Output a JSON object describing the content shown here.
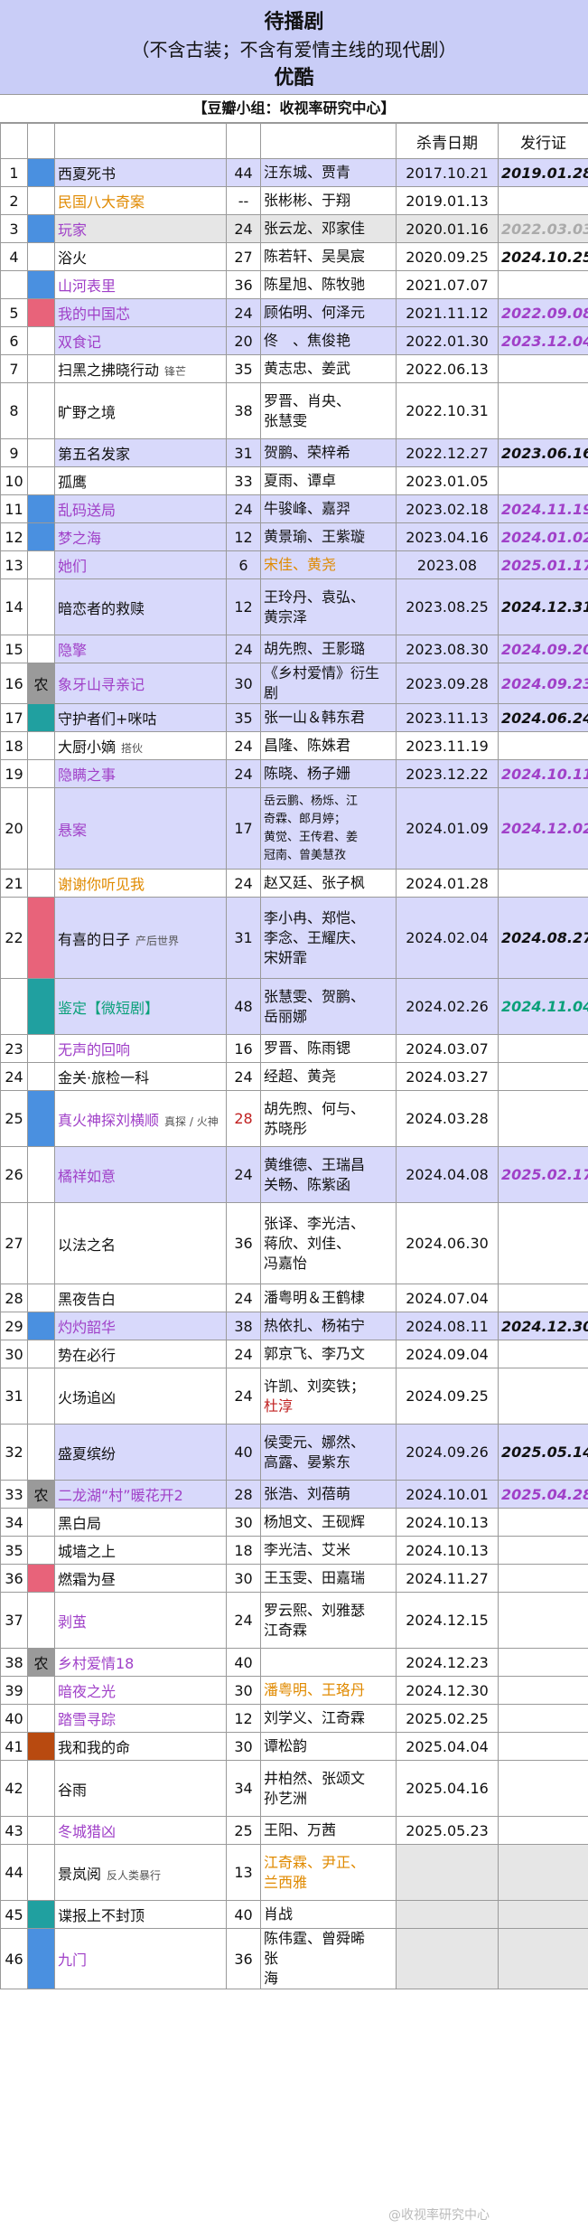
{
  "title": "待播剧",
  "subtitle": "（不含古装；不含有爱情主线的现代剧）",
  "platform": "优酷",
  "group": "【豆瓣小组：收视率研究中心】",
  "columns": {
    "wrap_date": "杀青日期",
    "license": "发行证"
  },
  "rows": [
    {
      "no": "1",
      "mark": "#4a90e0",
      "title": "西夏死书",
      "title_color": "#111",
      "tag": "",
      "ep": "44",
      "cast": [
        "汪东城、贾青"
      ],
      "date": "2017.10.21",
      "lic": "2019.01.28",
      "lic_color": "#111",
      "bg": "#d8d9fb",
      "h": 31
    },
    {
      "no": "2",
      "mark": "",
      "title": "民国八大奇案",
      "title_color": "#e08a00",
      "tag": "",
      "ep": "--",
      "cast": [
        "张彬彬、于翔"
      ],
      "date": "2019.01.13",
      "lic": "",
      "lic_color": "#111",
      "bg": "",
      "h": 31
    },
    {
      "no": "3",
      "mark": "#4a90e0",
      "title": "玩家",
      "title_color": "#a040c8",
      "tag": "",
      "ep": "24",
      "cast": [
        "张云龙、邓家佳"
      ],
      "date": "2020.01.16",
      "lic": "2022.03.03",
      "lic_color": "#aaaaaa",
      "bg": "#e6e6e6",
      "h": 31
    },
    {
      "no": "4",
      "mark": "",
      "title": "浴火",
      "title_color": "#111",
      "tag": "",
      "ep": "27",
      "cast": [
        "陈若轩、吴昊宸"
      ],
      "date": "2020.09.25",
      "lic": "2024.10.25",
      "lic_color": "#111",
      "bg": "",
      "h": 31
    },
    {
      "no": "",
      "mark": "#4a90e0",
      "title": "山河表里",
      "title_color": "#a040c8",
      "tag": "",
      "ep": "36",
      "cast": [
        "陈星旭、陈牧驰"
      ],
      "date": "2021.07.07",
      "lic": "",
      "lic_color": "#111",
      "bg": "",
      "h": 31
    },
    {
      "no": "5",
      "mark": "#e8637a",
      "title": "我的中国芯",
      "title_color": "#a040c8",
      "tag": "",
      "ep": "24",
      "cast": [
        "顾佑明、何泽元"
      ],
      "date": "2021.11.12",
      "lic": "2022.09.08",
      "lic_color": "#a040c8",
      "bg": "#d8d9fb",
      "h": 31
    },
    {
      "no": "6",
      "mark": "",
      "title": "双食记",
      "title_color": "#a040c8",
      "tag": "",
      "ep": "20",
      "cast": [
        "佟　、焦俊艳"
      ],
      "date": "2022.01.30",
      "lic": "2023.12.04",
      "lic_color": "#a040c8",
      "bg": "#d8d9fb",
      "h": 31
    },
    {
      "no": "7",
      "mark": "",
      "title": "扫黑之拂晓行动",
      "title_color": "#111",
      "tag": "锋芒",
      "ep": "35",
      "cast": [
        "黄志忠、姜武"
      ],
      "date": "2022.06.13",
      "lic": "",
      "lic_color": "#111",
      "bg": "",
      "h": 31
    },
    {
      "no": "8",
      "mark": "",
      "title": "旷野之境",
      "title_color": "#111",
      "tag": "",
      "ep": "38",
      "cast": [
        "罗晋、肖央、",
        "张慧雯"
      ],
      "date": "2022.10.31",
      "lic": "",
      "lic_color": "#111",
      "bg": "",
      "h": 62
    },
    {
      "no": "9",
      "mark": "",
      "title": "第五名发家",
      "title_color": "#111",
      "tag": "",
      "ep": "31",
      "cast": [
        "贺鹏、荣梓希"
      ],
      "date": "2022.12.27",
      "lic": "2023.06.16",
      "lic_color": "#111",
      "bg": "#d8d9fb",
      "h": 31
    },
    {
      "no": "10",
      "mark": "",
      "title": "孤鹰",
      "title_color": "#111",
      "tag": "",
      "ep": "33",
      "cast": [
        "夏雨、谭卓"
      ],
      "date": "2023.01.05",
      "lic": "",
      "lic_color": "#111",
      "bg": "",
      "h": 31
    },
    {
      "no": "11",
      "mark": "#4a90e0",
      "title": "乱码送局",
      "title_color": "#a040c8",
      "tag": "",
      "ep": "24",
      "cast": [
        "牛骏峰、嘉羿"
      ],
      "date": "2023.02.18",
      "lic": "2024.11.19",
      "lic_color": "#a040c8",
      "bg": "#d8d9fb",
      "h": 31
    },
    {
      "no": "12",
      "mark": "#4a90e0",
      "title": "梦之海",
      "title_color": "#a040c8",
      "tag": "",
      "ep": "12",
      "cast": [
        "黄景瑜、王紫璇"
      ],
      "date": "2023.04.16",
      "lic": "2024.01.02",
      "lic_color": "#a040c8",
      "bg": "#d8d9fb",
      "h": 31
    },
    {
      "no": "13",
      "mark": "",
      "title": "她们",
      "title_color": "#a040c8",
      "tag": "",
      "ep": "6",
      "cast": [
        "宋佳、黄尧"
      ],
      "cast_color": "#e08a00",
      "date": "2023.08",
      "lic": "2025.01.17",
      "lic_color": "#a040c8",
      "bg": "#d8d9fb",
      "h": 31
    },
    {
      "no": "14",
      "mark": "",
      "title": "暗恋者的救赎",
      "title_color": "#111",
      "tag": "",
      "ep": "12",
      "cast": [
        "王玲丹、袁弘、",
        "黄宗泽"
      ],
      "date": "2023.08.25",
      "lic": "2024.12.31",
      "lic_color": "#111",
      "bg": "#d8d9fb",
      "h": 62
    },
    {
      "no": "15",
      "mark": "",
      "title": "隐擎",
      "title_color": "#a040c8",
      "tag": "",
      "ep": "24",
      "cast": [
        "胡先煦、王影璐"
      ],
      "date": "2023.08.30",
      "lic": "2024.09.20",
      "lic_color": "#a040c8",
      "bg": "#d8d9fb",
      "h": 31
    },
    {
      "no": "16",
      "mark": "农",
      "title": "象牙山寻亲记",
      "title_color": "#a040c8",
      "tag": "",
      "ep": "30",
      "cast": [
        "《乡村爱情》衍生剧"
      ],
      "date": "2023.09.28",
      "lic": "2024.09.23",
      "lic_color": "#a040c8",
      "bg": "#d8d9fb",
      "h": 31
    },
    {
      "no": "17",
      "mark": "#20a0a0",
      "title": "守护者们+咪咕",
      "title_color": "#111",
      "tag": "",
      "ep": "35",
      "cast": [
        "张一山＆韩东君"
      ],
      "date": "2023.11.13",
      "lic": "2024.06.24",
      "lic_color": "#111",
      "bg": "#d8d9fb",
      "h": 31
    },
    {
      "no": "18",
      "mark": "",
      "title": "大厨小嫡",
      "title_color": "#111",
      "tag": "搭伙",
      "ep": "24",
      "cast": [
        "昌隆、陈姝君"
      ],
      "date": "2023.11.19",
      "lic": "",
      "lic_color": "#111",
      "bg": "",
      "h": 31
    },
    {
      "no": "19",
      "mark": "",
      "title": "隐瞒之事",
      "title_color": "#a040c8",
      "tag": "",
      "ep": "24",
      "cast": [
        "陈晓、杨子姗"
      ],
      "date": "2023.12.22",
      "lic": "2024.10.11",
      "lic_color": "#a040c8",
      "bg": "#d8d9fb",
      "h": 31
    },
    {
      "no": "20",
      "mark": "",
      "title": "悬案",
      "title_color": "#a040c8",
      "tag": "",
      "ep": "17",
      "cast": [
        "岳云鹏、杨烁、江",
        "奇霖、郎月婷；",
        "黄觉、王传君、姜",
        "冠南、曾美慧孜"
      ],
      "small": true,
      "date": "2024.01.09",
      "lic": "2024.12.02",
      "lic_color": "#a040c8",
      "bg": "#d8d9fb",
      "h": 90
    },
    {
      "no": "21",
      "mark": "",
      "title": "谢谢你听见我",
      "title_color": "#e08a00",
      "tag": "",
      "ep": "24",
      "cast": [
        "赵又廷、张子枫"
      ],
      "date": "2024.01.28",
      "lic": "",
      "lic_color": "#111",
      "bg": "",
      "h": 31
    },
    {
      "no": "22",
      "mark": "#e8637a",
      "title": "有喜的日子",
      "title_color": "#111",
      "tag": "产后世界",
      "ep": "31",
      "cast": [
        "李小冉、郑恺、",
        "李念、王耀庆、",
        "宋妍霏"
      ],
      "date": "2024.02.04",
      "lic": "2024.08.27",
      "lic_color": "#111",
      "bg": "#d8d9fb",
      "h": 90
    },
    {
      "no": "",
      "mark": "#20a0a0",
      "title": "鉴定【微短剧】",
      "title_color": "#0aa07a",
      "tag": "",
      "ep": "48",
      "cast": [
        "张慧雯、贺鹏、",
        "岳丽娜"
      ],
      "date": "2024.02.26",
      "lic": "2024.11.04",
      "lic_color": "#0aa07a",
      "bg": "#d8d9fb",
      "h": 62
    },
    {
      "no": "23",
      "mark": "",
      "title": "无声的回响",
      "title_color": "#a040c8",
      "tag": "",
      "ep": "16",
      "cast": [
        "罗晋、陈雨锶"
      ],
      "date": "2024.03.07",
      "lic": "",
      "lic_color": "#111",
      "bg": "",
      "h": 31
    },
    {
      "no": "24",
      "mark": "",
      "title": "金关·旅检一科",
      "title_color": "#111",
      "tag": "",
      "ep": "24",
      "cast": [
        "经超、黄尧"
      ],
      "date": "2024.03.27",
      "lic": "",
      "lic_color": "#111",
      "bg": "",
      "h": 31
    },
    {
      "no": "25",
      "mark": "#4a90e0",
      "title": "真火神探刘横顺",
      "title_color": "#a040c8",
      "tag": "真探 / 火神",
      "ep": "28",
      "ep_color": "#c02020",
      "cast": [
        "胡先煦、何与、",
        "苏晓彤"
      ],
      "date": "2024.03.28",
      "lic": "",
      "lic_color": "#111",
      "bg": "",
      "h": 62
    },
    {
      "no": "26",
      "mark": "",
      "title": "橘祥如意",
      "title_color": "#a040c8",
      "tag": "",
      "ep": "24",
      "cast": [
        "黄维德、王瑞昌",
        "关畅、陈紫函"
      ],
      "date": "2024.04.08",
      "lic": "2025.02.17",
      "lic_color": "#a040c8",
      "bg": "#d8d9fb",
      "h": 62
    },
    {
      "no": "27",
      "mark": "",
      "title": "以法之名",
      "title_color": "#111",
      "tag": "",
      "ep": "36",
      "cast": [
        "张译、李光洁、",
        "蒋欣、刘佳、",
        "冯嘉怡"
      ],
      "date": "2024.06.30",
      "lic": "",
      "lic_color": "#111",
      "bg": "",
      "h": 90
    },
    {
      "no": "28",
      "mark": "",
      "title": "黑夜告白",
      "title_color": "#111",
      "tag": "",
      "ep": "24",
      "cast": [
        "潘粤明＆王鹤棣"
      ],
      "date": "2024.07.04",
      "lic": "",
      "lic_color": "#111",
      "bg": "",
      "h": 31
    },
    {
      "no": "29",
      "mark": "#4a90e0",
      "title": "灼灼韶华",
      "title_color": "#a040c8",
      "tag": "",
      "ep": "38",
      "cast": [
        "热依扎、杨祐宁"
      ],
      "date": "2024.08.11",
      "lic": "2024.12.30",
      "lic_color": "#111",
      "bg": "#d8d9fb",
      "h": 31
    },
    {
      "no": "30",
      "mark": "",
      "title": "势在必行",
      "title_color": "#111",
      "tag": "",
      "ep": "24",
      "cast": [
        "郭京飞、李乃文"
      ],
      "date": "2024.09.04",
      "lic": "",
      "lic_color": "#111",
      "bg": "",
      "h": 31
    },
    {
      "no": "31",
      "mark": "",
      "title": "火场追凶",
      "title_color": "#111",
      "tag": "",
      "ep": "24",
      "cast": [
        "许凯、刘奕铁；",
        "杜淳"
      ],
      "cast2_color": "#c02020",
      "date": "2024.09.25",
      "lic": "",
      "lic_color": "#111",
      "bg": "",
      "h": 62
    },
    {
      "no": "32",
      "mark": "",
      "title": "盛夏缤纷",
      "title_color": "#111",
      "tag": "",
      "ep": "40",
      "cast": [
        "侯雯元、娜然、",
        "高露、晏紫东"
      ],
      "date": "2024.09.26",
      "lic": "2025.05.14",
      "lic_color": "#111",
      "bg": "#d8d9fb",
      "h": 62
    },
    {
      "no": "33",
      "mark": "农",
      "title": "二龙湖“村”暖花开2",
      "title_color": "#a040c8",
      "tag": "",
      "ep": "28",
      "cast": [
        "张浩、刘蓓萌"
      ],
      "date": "2024.10.01",
      "lic": "2025.04.28",
      "lic_color": "#a040c8",
      "bg": "#d8d9fb",
      "h": 31
    },
    {
      "no": "34",
      "mark": "",
      "title": "黑白局",
      "title_color": "#111",
      "tag": "",
      "ep": "30",
      "cast": [
        "杨旭文、王砚辉"
      ],
      "date": "2024.10.13",
      "lic": "",
      "lic_color": "#111",
      "bg": "",
      "h": 31
    },
    {
      "no": "35",
      "mark": "",
      "title": "城墙之上",
      "title_color": "#111",
      "tag": "",
      "ep": "18",
      "cast": [
        "李光洁、艾米"
      ],
      "date": "2024.10.13",
      "lic": "",
      "lic_color": "#111",
      "bg": "",
      "h": 31
    },
    {
      "no": "36",
      "mark": "#e8637a",
      "title": "燃霜为昼",
      "title_color": "#111",
      "tag": "",
      "ep": "30",
      "cast": [
        "王玉雯、田嘉瑞"
      ],
      "date": "2024.11.27",
      "lic": "",
      "lic_color": "#111",
      "bg": "",
      "h": 31
    },
    {
      "no": "37",
      "mark": "",
      "title": "剥茧",
      "title_color": "#a040c8",
      "tag": "",
      "ep": "24",
      "cast": [
        "罗云熙、刘雅瑟",
        "江奇霖"
      ],
      "date": "2024.12.15",
      "lic": "",
      "lic_color": "#111",
      "bg": "",
      "h": 62
    },
    {
      "no": "38",
      "mark": "农",
      "title": "乡村爱情18",
      "title_color": "#a040c8",
      "tag": "",
      "ep": "40",
      "cast": [
        ""
      ],
      "date": "2024.12.23",
      "lic": "",
      "lic_color": "#111",
      "bg": "",
      "h": 31
    },
    {
      "no": "39",
      "mark": "",
      "title": "暗夜之光",
      "title_color": "#a040c8",
      "tag": "",
      "ep": "30",
      "cast": [
        "潘粤明、王珞丹"
      ],
      "cast_color": "#e08a00",
      "date": "2024.12.30",
      "lic": "",
      "lic_color": "#111",
      "bg": "",
      "h": 31
    },
    {
      "no": "40",
      "mark": "",
      "title": "踏雪寻踪",
      "title_color": "#a040c8",
      "tag": "",
      "ep": "12",
      "cast": [
        "刘学义、江奇霖"
      ],
      "date": "2025.02.25",
      "lic": "",
      "lic_color": "#111",
      "bg": "",
      "h": 31
    },
    {
      "no": "41",
      "mark": "#b84a10",
      "title": "我和我的命",
      "title_color": "#111",
      "tag": "",
      "ep": "30",
      "cast": [
        "谭松韵"
      ],
      "date": "2025.04.04",
      "lic": "",
      "lic_color": "#111",
      "bg": "",
      "h": 31
    },
    {
      "no": "42",
      "mark": "",
      "title": "谷雨",
      "title_color": "#111",
      "tag": "",
      "ep": "34",
      "cast": [
        "井柏然、张颂文",
        "孙艺洲"
      ],
      "date": "2025.04.16",
      "lic": "",
      "lic_color": "#111",
      "bg": "",
      "h": 62
    },
    {
      "no": "43",
      "mark": "",
      "title": "冬城猎凶",
      "title_color": "#a040c8",
      "tag": "",
      "ep": "25",
      "cast": [
        "王阳、万茜"
      ],
      "date": "2025.05.23",
      "lic": "",
      "lic_color": "#111",
      "bg": "",
      "h": 31
    },
    {
      "no": "44",
      "mark": "",
      "title": "景岚阅",
      "title_color": "#111",
      "tag": "反人类暴行",
      "ep": "13",
      "cast": [
        "江奇霖、尹正、",
        "兰西雅"
      ],
      "cast_color": "#e08a00",
      "date": "",
      "lic": "",
      "lic_color": "#111",
      "bg": "",
      "h": 62
    },
    {
      "no": "45",
      "mark": "#20a0a0",
      "title": "谍报上不封顶",
      "title_color": "#111",
      "tag": "",
      "ep": "40",
      "cast": [
        "肖战"
      ],
      "date": "",
      "lic": "",
      "lic_color": "#111",
      "bg": "",
      "h": 31
    },
    {
      "no": "46",
      "mark": "#4a90e0",
      "title": "九门",
      "title_color": "#a040c8",
      "tag": "",
      "ep": "36",
      "cast": [
        "陈伟霆、曾舜晞",
        "张",
        "海"
      ],
      "date": "",
      "lic": "",
      "lic_color": "#111",
      "bg": "",
      "h": 62
    }
  ],
  "watermark": "@收视率研究中心"
}
